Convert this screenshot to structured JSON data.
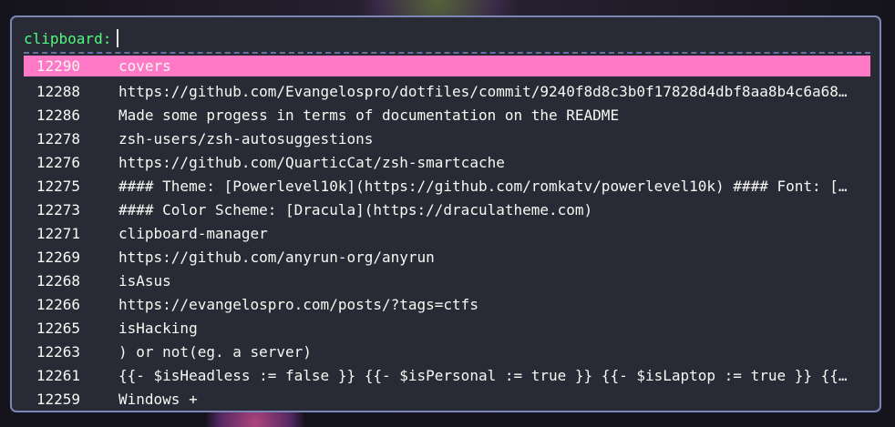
{
  "prompt": {
    "label": "clipboard:",
    "query": ""
  },
  "colors": {
    "window_bg": "#282a36",
    "border": "#7c86b4",
    "prompt": "#50fa7b",
    "selection": "#ff79c6",
    "text": "#f8f8f2",
    "separator": "#6272a4"
  },
  "entries": [
    {
      "id": "12290",
      "text": "covers",
      "selected": true
    },
    {
      "id": "12288",
      "text": "https://github.com/Evangelospro/dotfiles/commit/9240f8d8c3b0f17828d4dbf8aa8b4c6a68…"
    },
    {
      "id": "12286",
      "text": "Made some progess in terms of documentation on the README"
    },
    {
      "id": "12278",
      "text": "zsh-users/zsh-autosuggestions"
    },
    {
      "id": "12276",
      "text": "https://github.com/QuarticCat/zsh-smartcache"
    },
    {
      "id": "12275",
      "text": "#### Theme: [Powerlevel10k](https://github.com/romkatv/powerlevel10k) #### Font: […"
    },
    {
      "id": "12273",
      "text": "#### Color Scheme: [Dracula](https://draculatheme.com)"
    },
    {
      "id": "12271",
      "text": "clipboard-manager"
    },
    {
      "id": "12269",
      "text": "https://github.com/anyrun-org/anyrun"
    },
    {
      "id": "12268",
      "text": "isAsus"
    },
    {
      "id": "12266",
      "text": "https://evangelospro.com/posts/?tags=ctfs"
    },
    {
      "id": "12265",
      "text": "isHacking"
    },
    {
      "id": "12263",
      "text": ") or not(eg. a server)"
    },
    {
      "id": "12261",
      "text": "{{- $isHeadless := false }} {{- $isPersonal := true }} {{- $isLaptop := true }} {{…"
    },
    {
      "id": "12259",
      "text": "Windows +"
    }
  ]
}
